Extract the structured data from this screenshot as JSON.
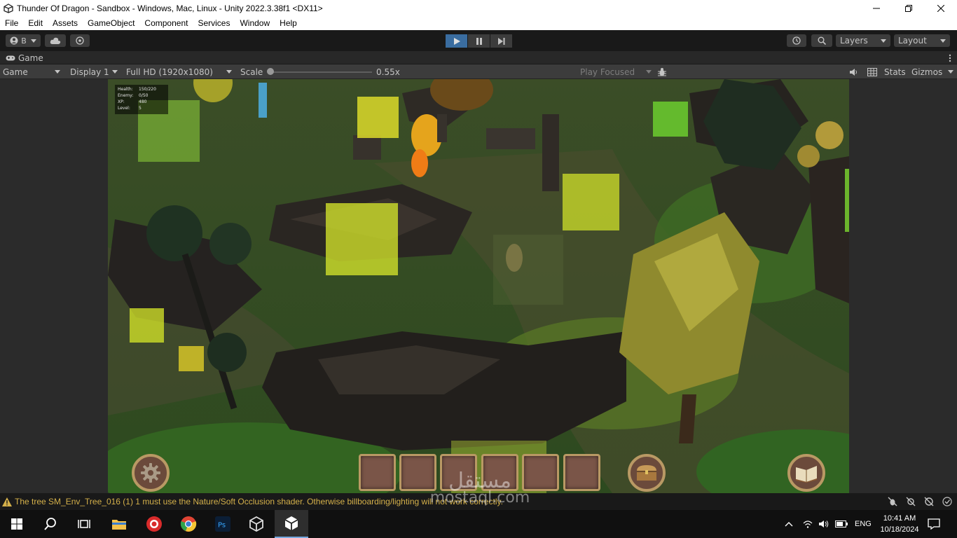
{
  "window": {
    "title": "Thunder Of Dragon - Sandbox - Windows, Mac, Linux - Unity 2022.3.38f1 <DX11>"
  },
  "menu": [
    "File",
    "Edit",
    "Assets",
    "GameObject",
    "Component",
    "Services",
    "Window",
    "Help"
  ],
  "toolbar": {
    "account_label": "B",
    "layers_label": "Layers",
    "layout_label": "Layout"
  },
  "game_tab": {
    "tab_label": "Game",
    "view_mode": "Game",
    "display": "Display 1",
    "resolution": "Full HD (1920x1080)",
    "scale_label": "Scale",
    "scale_value": "0.55x",
    "scale_fraction": 0.02,
    "play_mode": "Play Focused",
    "stats_label": "Stats",
    "gizmos_label": "Gizmos"
  },
  "hud": {
    "rows": [
      {
        "key": "Health:",
        "value": "150/220"
      },
      {
        "key": "Enemy:",
        "value": "0/50"
      },
      {
        "key": "XP:",
        "value": "480"
      },
      {
        "key": "Level:",
        "value": "5"
      }
    ]
  },
  "console": {
    "warning_message": "The tree SM_Env_Tree_016 (1) 1 must use the Nature/Soft Occlusion shader. Otherwise billboarding/lighting will not work correctly."
  },
  "taskbar": {
    "language": "ENG",
    "time": "10:41 AM",
    "date": "10/18/2024"
  },
  "watermark": {
    "arabic": "مستقل",
    "latin": "mostaql.com"
  },
  "colors": {
    "play_active": "#3a6da0",
    "warning": "#d4b04a",
    "slot_border": "#b99964"
  }
}
